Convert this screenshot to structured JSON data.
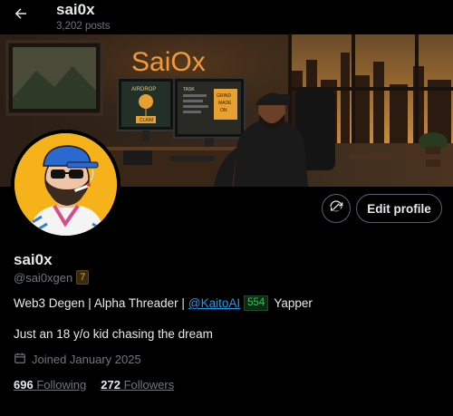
{
  "header": {
    "name": "sai0x",
    "posts": "3,202 posts"
  },
  "banner": {
    "neon_text": "SaiOx",
    "screen_left": [
      "AIRDROP",
      "CLAIM"
    ],
    "screen_right": [
      "TASK",
      "GRIND",
      "MADE",
      "ON"
    ]
  },
  "actions": {
    "edit_profile": "Edit profile"
  },
  "profile": {
    "display_name": "sai0x",
    "handle": "@sai0xgen",
    "handle_badge": "7",
    "bio_text": "Web3 Degen | Alpha Threader |",
    "bio_link": "@KaitoAI",
    "bio_badge": "554",
    "bio_suffix": "Yapper",
    "bio_line2": "Just an 18 y/o kid chasing the dream",
    "joined": "Joined January 2025",
    "following_count": "696",
    "following_label": "Following",
    "followers_count": "272",
    "followers_label": "Followers"
  },
  "colors": {
    "background": "#000000",
    "text": "#e7e9ea",
    "muted": "#71767b",
    "link": "#1d9bf0",
    "neon": "#f29a3a",
    "avatar_bg": "#f6b21a"
  }
}
